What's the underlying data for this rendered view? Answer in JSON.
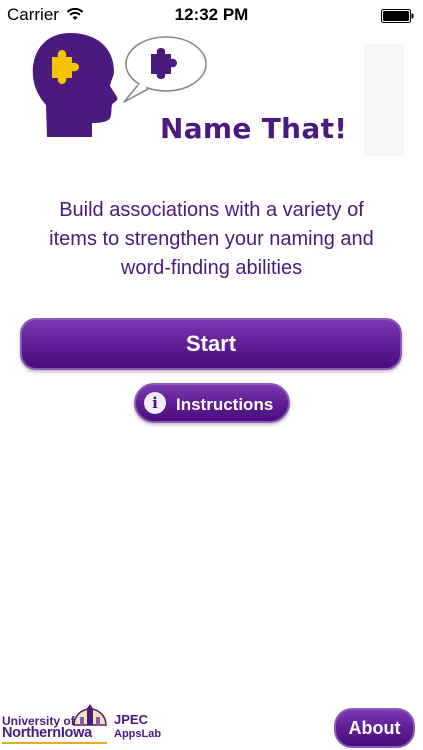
{
  "status_bar": {
    "carrier": "Carrier",
    "time": "12:32 PM",
    "wifi_icon": "wifi-icon",
    "battery_icon": "battery-icon"
  },
  "header": {
    "logo_text": "Name That!",
    "head_icon": "head-with-puzzle-icon",
    "bubble_icon": "speech-bubble-puzzle-icon"
  },
  "tagline": {
    "line1": "Build associations with a variety of",
    "line2": "items to strengthen your naming and",
    "line3": "word-finding abilities"
  },
  "buttons": {
    "start": "Start",
    "instructions": "Instructions",
    "info_glyph": "i",
    "about": "About"
  },
  "footer": {
    "university_small": "University of",
    "university_large": "NorthernIowa",
    "jpec": "JPEC",
    "appslab": "AppsLab"
  },
  "colors": {
    "brand_purple": "#4b1a7e",
    "button_purple": "#5d1c93",
    "puzzle_yellow": "#f5c400",
    "uni_gold": "#e0b020"
  }
}
